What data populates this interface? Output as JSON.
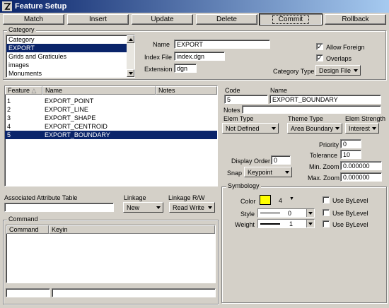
{
  "window": {
    "title": "Feature Setup",
    "icon": "microstation-icon"
  },
  "toolbar": {
    "match": "Match",
    "insert": "Insert",
    "update": "Update",
    "delete": "Delete",
    "commit": "Commit",
    "rollback": "Rollback"
  },
  "category": {
    "group_label": "Category",
    "list_header": "Category",
    "items": [
      "EXPORT",
      "Grids and Graticules",
      "images",
      "Monuments"
    ],
    "selected_index": 0,
    "name_label": "Name",
    "name_value": "EXPORT",
    "index_file_label": "Index File",
    "index_file_value": "index.dgn",
    "extension_label": "Extension",
    "extension_value": "dgn",
    "allow_foreign_label": "Allow Foreign",
    "allow_foreign_checked": true,
    "overlaps_label": "Overlaps",
    "overlaps_checked": true,
    "category_type_label": "Category Type",
    "category_type_value": "Design File"
  },
  "feature_table": {
    "columns": [
      "Feature",
      "Name",
      "Notes"
    ],
    "rows": [
      {
        "feature": "1",
        "name": "EXPORT_POINT",
        "notes": ""
      },
      {
        "feature": "2",
        "name": "EXPORT_LINE",
        "notes": ""
      },
      {
        "feature": "3",
        "name": "EXPORT_SHAPE",
        "notes": ""
      },
      {
        "feature": "4",
        "name": "EXPORT_CENTROID",
        "notes": ""
      },
      {
        "feature": "5",
        "name": "EXPORT_BOUNDARY",
        "notes": ""
      }
    ],
    "selected_index": 4
  },
  "feature": {
    "code_label": "Code",
    "code_value": "5",
    "name_label": "Name",
    "name_value": "EXPORT_BOUNDARY",
    "notes_label": "Notes",
    "notes_value": "",
    "elem_type_label": "Elem Type",
    "elem_type_value": "Not Defined",
    "theme_type_label": "Theme Type",
    "theme_type_value": "Area Boundary",
    "elem_strength_label": "Elem Strength",
    "elem_strength_value": "Interest",
    "priority_label": "Priority",
    "priority_value": "0",
    "tolerance_label": "Tolerance",
    "tolerance_value": "10",
    "min_zoom_label": "Min. Zoom",
    "min_zoom_value": "0.000000",
    "max_zoom_label": "Max. Zoom",
    "max_zoom_value": "0.000000",
    "display_order_label": "Display Order",
    "display_order_value": "0",
    "snap_label": "Snap",
    "snap_value": "Keypoint"
  },
  "symbology": {
    "group_label": "Symbology",
    "color_label": "Color",
    "color_value": "4",
    "color_swatch": "#ffff00",
    "style_label": "Style",
    "style_value": "0",
    "weight_label": "Weight",
    "weight_value": "1",
    "use_bylevel_label": "Use ByLevel"
  },
  "linkage": {
    "assoc_table_label": "Associated Attribute Table",
    "assoc_table_value": "",
    "linkage_label": "Linkage",
    "linkage_value": "New",
    "linkage_rw_label": "Linkage R/W",
    "linkage_rw_value": "Read Write"
  },
  "command": {
    "group_label": "Command",
    "columns": [
      "Command",
      "Keyin"
    ],
    "field1": "",
    "field2": ""
  }
}
